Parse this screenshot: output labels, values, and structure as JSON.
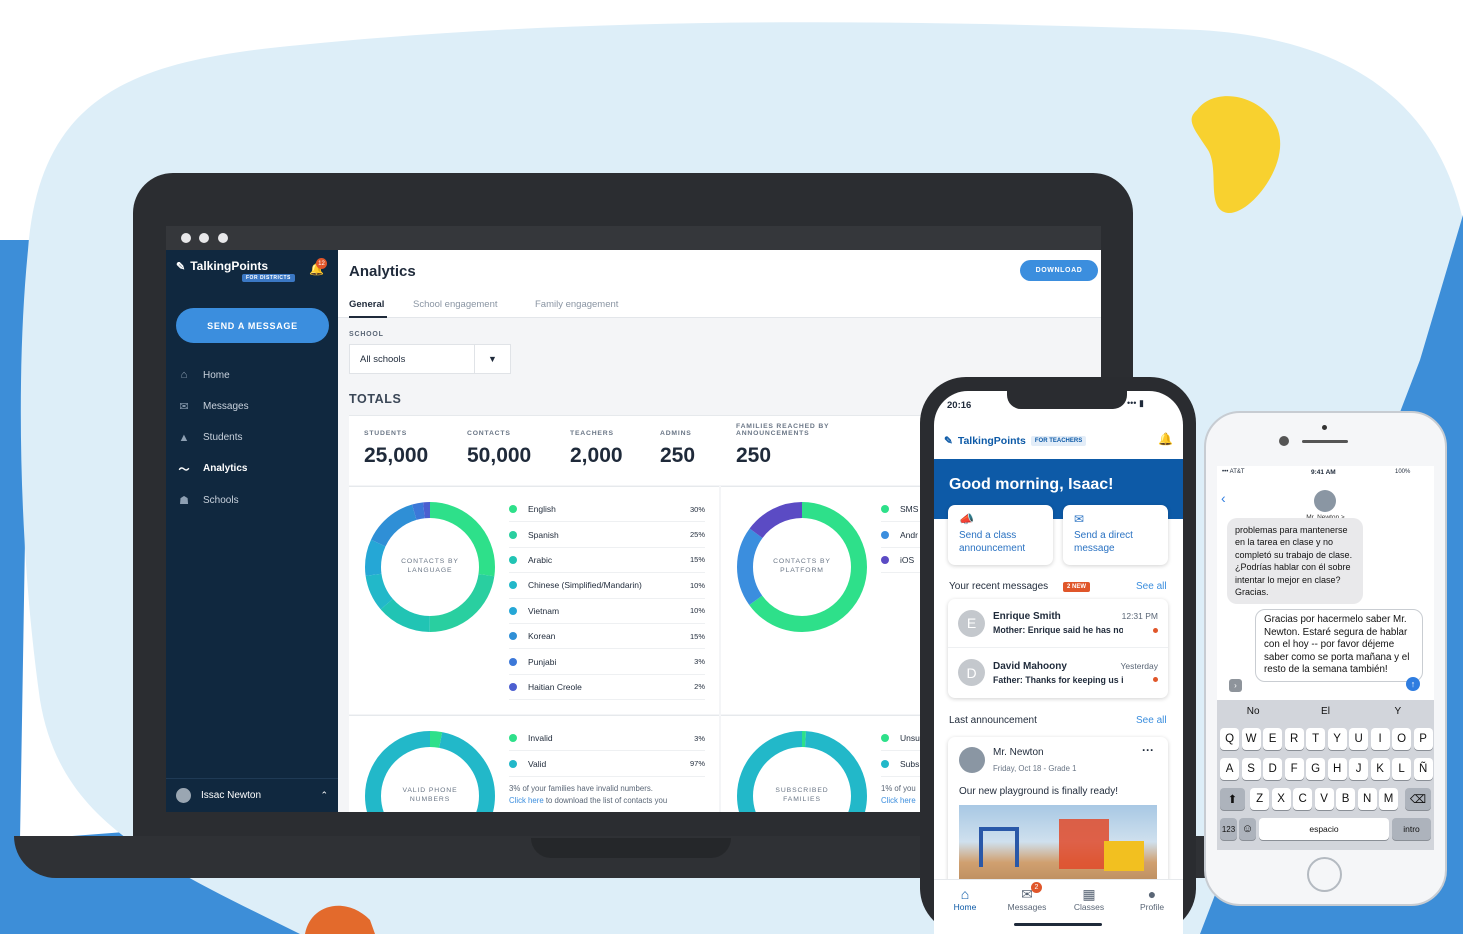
{
  "colors": {
    "primary": "#3b8ede",
    "navy": "#10283f",
    "phone_blue": "#0d5aa7",
    "yellow": "#f8d12f",
    "orange": "#e36a2c"
  },
  "laptop": {
    "app": {
      "brand": "TalkingPoints",
      "brand_tag": "FOR DISTRICTS",
      "notif_count": "12",
      "send_button": "SEND A MESSAGE"
    },
    "nav": [
      {
        "label": "Home",
        "icon": "home-icon"
      },
      {
        "label": "Messages",
        "icon": "mail-icon"
      },
      {
        "label": "Students",
        "icon": "graduation-cap-icon"
      },
      {
        "label": "Analytics",
        "icon": "analytics-icon",
        "active": true
      },
      {
        "label": "Schools",
        "icon": "school-building-icon"
      }
    ],
    "user": {
      "name": "Issac Newton"
    },
    "header": {
      "title": "Analytics",
      "download": "DOWNLOAD"
    },
    "tabs": [
      "General",
      "School engagement",
      "Family engagement"
    ],
    "filter": {
      "label": "SCHOOL",
      "value": "All schools"
    },
    "totals": {
      "title": "TOTALS",
      "stats": [
        {
          "label": "STUDENTS",
          "value": "25,000"
        },
        {
          "label": "CONTACTS",
          "value": "50,000"
        },
        {
          "label": "TEACHERS",
          "value": "2,000"
        },
        {
          "label": "ADMINS",
          "value": "250"
        },
        {
          "label": "FAMILIES REACHED BY ANNOUNCEMENTS",
          "value": "250"
        }
      ]
    },
    "language_panel": {
      "donut_label": "CONTACTS BY LANGUAGE",
      "items": [
        {
          "name": "English",
          "pct": "30%",
          "value": 30,
          "color": "#2ee08a"
        },
        {
          "name": "Spanish",
          "pct": "25%",
          "value": 25,
          "color": "#29cfa0"
        },
        {
          "name": "Arabic",
          "pct": "15%",
          "value": 15,
          "color": "#21c4b4"
        },
        {
          "name": "Chinese (Simplified/Mandarin)",
          "pct": "10%",
          "value": 10,
          "color": "#22b8c9"
        },
        {
          "name": "Vietnam",
          "pct": "10%",
          "value": 10,
          "color": "#25a7d6"
        },
        {
          "name": "Korean",
          "pct": "15%",
          "value": 15,
          "color": "#2f8fd6"
        },
        {
          "name": "Punjabi",
          "pct": "3%",
          "value": 3,
          "color": "#3c78d8"
        },
        {
          "name": "Haitian Creole",
          "pct": "2%",
          "value": 2,
          "color": "#4c5fd0"
        }
      ]
    },
    "platform_panel": {
      "donut_label": "CONTACTS BY PLATFORM",
      "items": [
        {
          "name": "SMS",
          "value": 65,
          "color": "#2ee08a"
        },
        {
          "name": "Andr",
          "value": 20,
          "color": "#3b8ede"
        },
        {
          "name": "iOS",
          "value": 15,
          "color": "#5b4bc4"
        }
      ]
    },
    "phone_panel": {
      "donut_label": "VALID PHONE NUMBERS",
      "items": [
        {
          "name": "Invalid",
          "pct": "3%",
          "value": 3,
          "color": "#2ee08a"
        },
        {
          "name": "Valid",
          "pct": "97%",
          "value": 97,
          "color": "#22b8c9"
        }
      ],
      "note_pct": "3%",
      "note_text": " of your families have invalid numbers.",
      "link": "Click here",
      "link_suffix": " to download the list of contacts you"
    },
    "subscribed_panel": {
      "donut_label": "SUBSCRIBED FAMILIES",
      "items": [
        {
          "name": "Unsu",
          "value": 1,
          "color": "#2ee08a"
        },
        {
          "name": "Subs",
          "value": 99,
          "color": "#22b8c9"
        }
      ],
      "note": "1% of you",
      "link": "Click here"
    }
  },
  "phone1": {
    "time": "20:16",
    "brand": "TalkingPoints",
    "brand_tag": "FOR TEACHERS",
    "greeting": "Good morning, Isaac!",
    "actions": [
      "Send a class announcement",
      "Send a direct message"
    ],
    "recent": {
      "title": "Your recent messages",
      "badge": "2 NEW",
      "see_all": "See all"
    },
    "messages": [
      {
        "initial": "E",
        "name": "Enrique Smith",
        "time": "12:31 PM",
        "preview": "Mother: Enrique said he has no..."
      },
      {
        "initial": "D",
        "name": "David Mahoony",
        "time": "Yesterday",
        "preview": "Father: Thanks for keeping us inf..."
      }
    ],
    "last": {
      "title": "Last announcement",
      "see_all": "See all",
      "author": "Mr. Newton",
      "meta": "Friday, Oct 18 - Grade 1",
      "text": "Our new playground is finally ready!"
    },
    "tabbar": [
      {
        "label": "Home",
        "icon": "home-icon"
      },
      {
        "label": "Messages",
        "icon": "chat-icon",
        "badge": "2"
      },
      {
        "label": "Classes",
        "icon": "clipboard-icon"
      },
      {
        "label": "Profile",
        "icon": "person-icon"
      }
    ]
  },
  "phone2": {
    "carrier": "AT&T",
    "time": "9:41 AM",
    "battery": "100%",
    "contact": "Mr. Newton >",
    "incoming": "problemas para mantenerse en la tarea en clase y no completó su trabajo de clase. ¿Podrías hablar con él sobre intentar lo mejor en clase? Gracias.",
    "outgoing": "Gracias por hacermelo saber Mr. Newton. Estaré segura de hablar con el hoy -- por favor déjeme saber como se porta mañana y el resto de la semana también!",
    "suggestions": [
      "No",
      "El",
      "Y"
    ],
    "rows": [
      [
        "Q",
        "W",
        "E",
        "R",
        "T",
        "Y",
        "U",
        "I",
        "O",
        "P"
      ],
      [
        "A",
        "S",
        "D",
        "F",
        "G",
        "H",
        "J",
        "K",
        "L",
        "Ñ"
      ],
      [
        "Z",
        "X",
        "C",
        "V",
        "B",
        "N",
        "M"
      ]
    ],
    "bottom": {
      "num": "123",
      "space": "espacio",
      "enter": "intro"
    }
  }
}
